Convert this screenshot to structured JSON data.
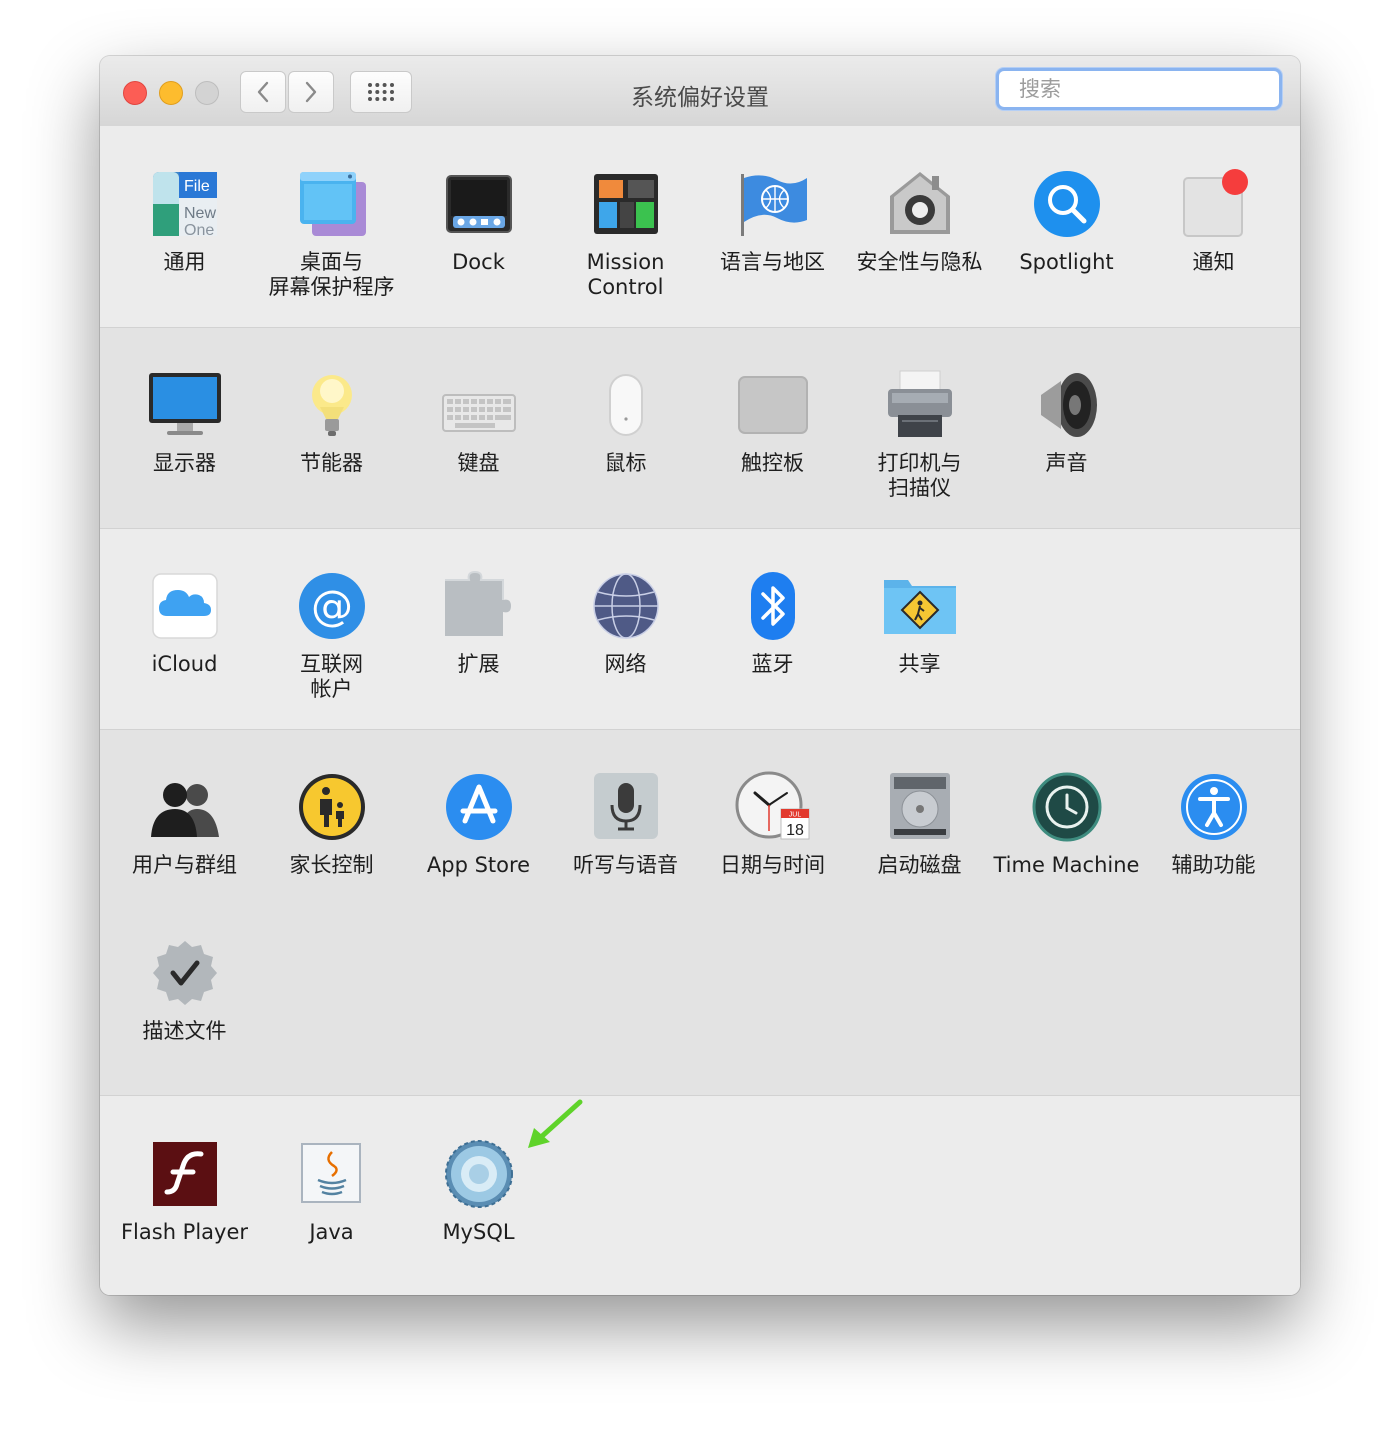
{
  "window": {
    "title": "系统偏好设置",
    "search_placeholder": "搜索"
  },
  "rows": [
    {
      "panes": [
        {
          "label": "通用",
          "icon": "general-icon"
        },
        {
          "label": "桌面与\n屏幕保护程序",
          "icon": "desktop-screensaver-icon"
        },
        {
          "label": "Dock",
          "icon": "dock-icon"
        },
        {
          "label": "Mission\nControl",
          "icon": "mission-control-icon"
        },
        {
          "label": "语言与地区",
          "icon": "language-region-icon"
        },
        {
          "label": "安全性与隐私",
          "icon": "security-privacy-icon"
        },
        {
          "label": "Spotlight",
          "icon": "spotlight-icon"
        },
        {
          "label": "通知",
          "icon": "notifications-icon"
        }
      ]
    },
    {
      "panes": [
        {
          "label": "显示器",
          "icon": "displays-icon"
        },
        {
          "label": "节能器",
          "icon": "energy-saver-icon"
        },
        {
          "label": "键盘",
          "icon": "keyboard-icon"
        },
        {
          "label": "鼠标",
          "icon": "mouse-icon"
        },
        {
          "label": "触控板",
          "icon": "trackpad-icon"
        },
        {
          "label": "打印机与\n扫描仪",
          "icon": "printers-scanners-icon"
        },
        {
          "label": "声音",
          "icon": "sound-icon"
        }
      ]
    },
    {
      "panes": [
        {
          "label": "iCloud",
          "icon": "icloud-icon"
        },
        {
          "label": "互联网\n帐户",
          "icon": "internet-accounts-icon"
        },
        {
          "label": "扩展",
          "icon": "extensions-icon"
        },
        {
          "label": "网络",
          "icon": "network-icon"
        },
        {
          "label": "蓝牙",
          "icon": "bluetooth-icon"
        },
        {
          "label": "共享",
          "icon": "sharing-icon"
        }
      ]
    },
    {
      "panes": [
        {
          "label": "用户与群组",
          "icon": "users-groups-icon"
        },
        {
          "label": "家长控制",
          "icon": "parental-controls-icon"
        },
        {
          "label": "App Store",
          "icon": "app-store-icon"
        },
        {
          "label": "听写与语音",
          "icon": "dictation-speech-icon"
        },
        {
          "label": "日期与时间",
          "icon": "date-time-icon"
        },
        {
          "label": "启动磁盘",
          "icon": "startup-disk-icon"
        },
        {
          "label": "Time Machine",
          "icon": "time-machine-icon"
        },
        {
          "label": "辅助功能",
          "icon": "accessibility-icon"
        },
        {
          "label": "描述文件",
          "icon": "profiles-icon"
        }
      ]
    },
    {
      "panes": [
        {
          "label": "Flash Player",
          "icon": "flash-player-icon"
        },
        {
          "label": "Java",
          "icon": "java-icon"
        },
        {
          "label": "MySQL",
          "icon": "mysql-icon"
        }
      ]
    }
  ],
  "calendar": {
    "month": "JUL",
    "day": "18"
  },
  "colors": {
    "close": "#fc5d55",
    "minimize": "#fdbc2e",
    "search_focus": "#8ab4f0",
    "annotation_arrow": "#5fd32a"
  }
}
